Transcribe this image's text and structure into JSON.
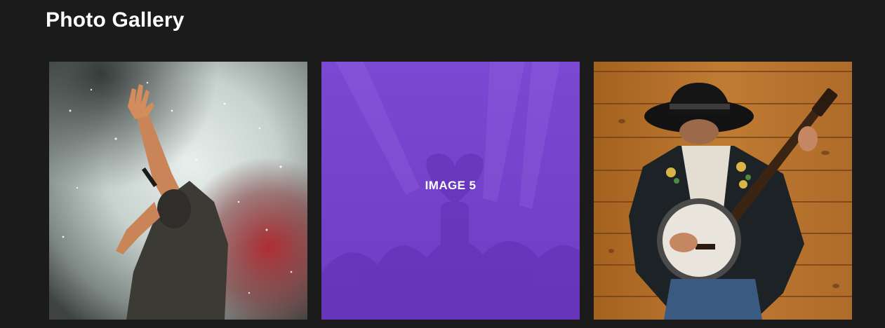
{
  "page": {
    "title": "Photo Gallery"
  },
  "gallery": {
    "items": [
      {
        "subject": "concert-singer-photo"
      },
      {
        "subject": "concert-crowd-photo",
        "overlay_label": "IMAGE 5",
        "overlay_color": "#7b45cf"
      },
      {
        "subject": "banjo-player-photo"
      }
    ]
  },
  "colors": {
    "background": "#1b1b1b",
    "accent_purple": "#7b45cf",
    "wood": "#b8732c"
  }
}
